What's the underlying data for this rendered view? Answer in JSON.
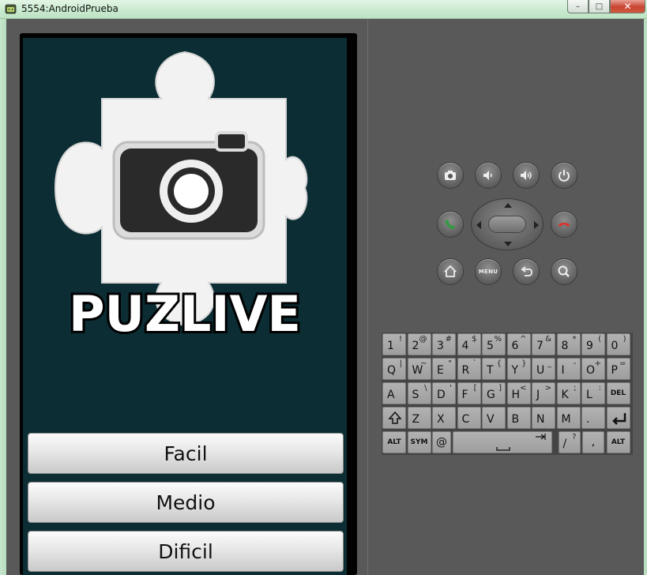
{
  "window": {
    "title": "5554:AndroidPrueba",
    "minimize": "–",
    "maximize": "□",
    "close": "✕"
  },
  "app": {
    "logo_text": "PUZLIVE",
    "buttons": {
      "easy": "Facil",
      "medium": "Medio",
      "hard": "Dificil"
    }
  },
  "controls": {
    "menu_label": "MENU"
  },
  "keyboard": {
    "row1": [
      {
        "k": "1",
        "a": "!"
      },
      {
        "k": "2",
        "a": "@"
      },
      {
        "k": "3",
        "a": "#"
      },
      {
        "k": "4",
        "a": "$"
      },
      {
        "k": "5",
        "a": "%"
      },
      {
        "k": "6",
        "a": "^"
      },
      {
        "k": "7",
        "a": "&"
      },
      {
        "k": "8",
        "a": "*"
      },
      {
        "k": "9",
        "a": "("
      },
      {
        "k": "0",
        "a": ")"
      }
    ],
    "row2": [
      {
        "k": "Q",
        "a": "|"
      },
      {
        "k": "W",
        "a": "~"
      },
      {
        "k": "E",
        "a": "\""
      },
      {
        "k": "R",
        "a": "`"
      },
      {
        "k": "T",
        "a": "{"
      },
      {
        "k": "Y",
        "a": "}"
      },
      {
        "k": "U",
        "a": "_"
      },
      {
        "k": "I",
        "a": "-"
      },
      {
        "k": "O",
        "a": "+"
      },
      {
        "k": "P",
        "a": "="
      }
    ],
    "row3": [
      {
        "k": "A",
        "a": ""
      },
      {
        "k": "S",
        "a": "\\"
      },
      {
        "k": "D",
        "a": "'"
      },
      {
        "k": "F",
        "a": "["
      },
      {
        "k": "G",
        "a": "]"
      },
      {
        "k": "H",
        "a": "<"
      },
      {
        "k": "J",
        "a": ">"
      },
      {
        "k": "K",
        "a": ";"
      },
      {
        "k": "L",
        "a": ":"
      }
    ],
    "del": "DEL",
    "row4": [
      {
        "k": "Z",
        "a": ""
      },
      {
        "k": "X",
        "a": ""
      },
      {
        "k": "C",
        "a": ""
      },
      {
        "k": "V",
        "a": ""
      },
      {
        "k": "B",
        "a": ""
      },
      {
        "k": "N",
        "a": ""
      },
      {
        "k": "M",
        "a": ""
      },
      {
        "k": ".",
        "a": ""
      }
    ],
    "alt_left": "ALT",
    "sym": "SYM",
    "at": "@",
    "slash": "/",
    "slash_alt": "?",
    "comma": ",",
    "alt_right": "ALT"
  },
  "colors": {
    "screen_bg": "#0b2d33",
    "call_green": "#2f9c3d",
    "end_red": "#d8332a"
  },
  "icons": {
    "camera": "camera-icon",
    "volume_down": "volume-down-icon",
    "volume_up": "volume-up-icon",
    "power": "power-icon",
    "call": "call-icon",
    "end_call": "end-call-icon",
    "home": "home-icon",
    "back": "back-icon",
    "search": "search-icon"
  }
}
